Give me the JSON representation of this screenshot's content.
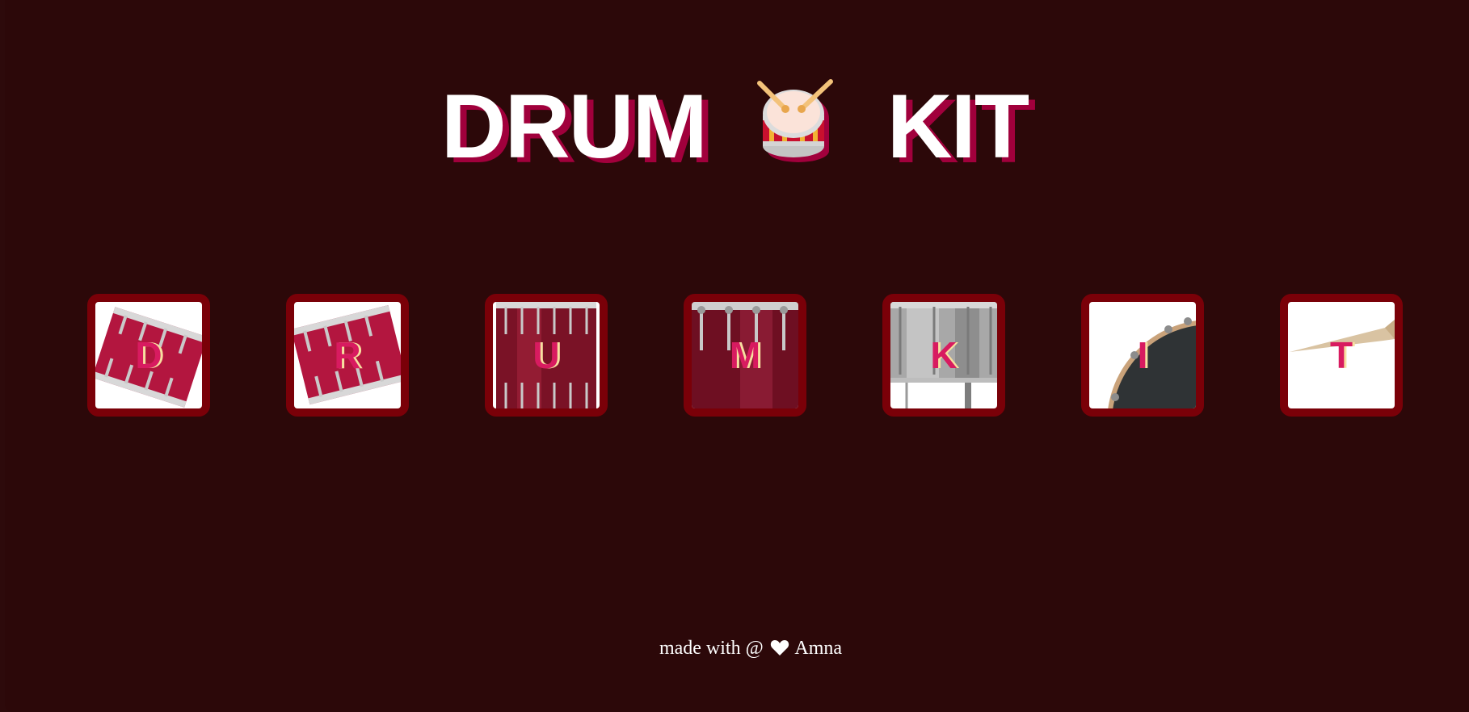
{
  "header": {
    "word_left": "DRUM",
    "word_right": "KIT",
    "emoji_icon": "drum-icon"
  },
  "keys": [
    {
      "label": "D",
      "image": "snare-drum-tilted"
    },
    {
      "label": "R",
      "image": "snare-drum-tilted"
    },
    {
      "label": "U",
      "image": "tom-drum"
    },
    {
      "label": "M",
      "image": "floor-tom-drum"
    },
    {
      "label": "K",
      "image": "kick-drum-silver"
    },
    {
      "label": "I",
      "image": "drum-head-edge"
    },
    {
      "label": "T",
      "image": "drumstick-tip"
    }
  ],
  "footer": {
    "prefix": "made with @",
    "author": "Amna",
    "heart_icon": "heart-icon"
  },
  "colors": {
    "background": "#2c0809",
    "key_border": "#7a0008",
    "title_shadow": "#a1003c",
    "key_letter": "#d81b60"
  }
}
